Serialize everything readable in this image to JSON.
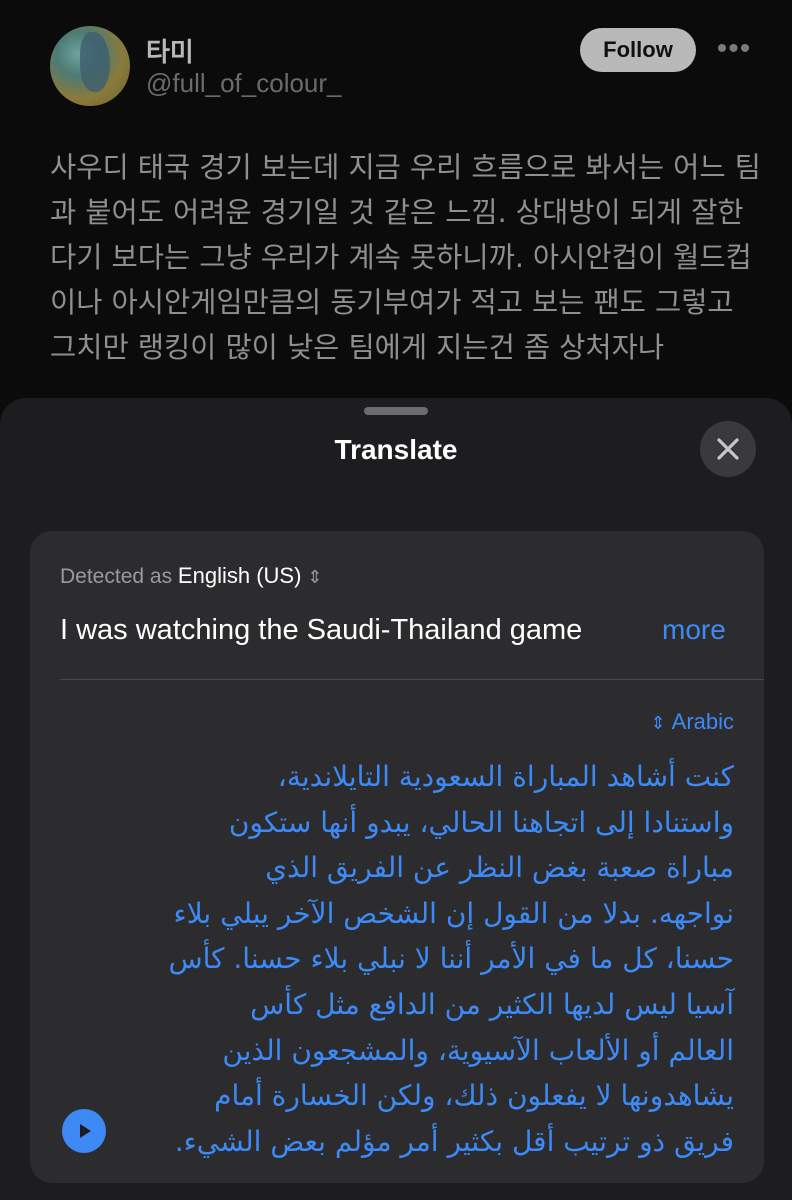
{
  "tweet": {
    "display_name": "타미",
    "handle": "@full_of_colour_",
    "follow_label": "Follow",
    "more_label": "•••",
    "text_lines": [
      "사우디 태국 경기 보는데 지금 우리 흐름으로 봐서는 어느 팀",
      "과 붙어도 어려운 경기일 것 같은 느낌. 상대방이 되게 잘한",
      "다기 보다는 그냥 우리가 계속 못하니까. 아시안컵이 월드컵",
      "이나 아시안게임만큼의 동기부여가 적고 보는 팬도 그렇고",
      "그치만 랭킹이 많이 낮은 팀에게 지는건 좀 상처자나"
    ]
  },
  "sheet": {
    "title": "Translate",
    "detected_prefix": "Detected as",
    "source_language": "English (US)",
    "source_text": "I was watching the Saudi-Thailand game",
    "more_label": "more",
    "target_language": "Arabic",
    "translation_lines": [
      "كنت أشاهد المباراة السعودية التايلاندية،",
      "واستنادا إلى اتجاهنا الحالي، يبدو أنها ستكون",
      "مباراة صعبة بغض النظر عن الفريق الذي",
      "نواجهه. بدلا من القول إن الشخص الآخر يبلي بلاء",
      "حسنا، كل ما في الأمر أننا لا نبلي بلاء حسنا. كأس",
      "آسيا ليس لديها الكثير من الدافع مثل كأس",
      "العالم أو الألعاب الآسيوية، والمشجعون الذين",
      "يشاهدونها لا يفعلون ذلك، ولكن الخسارة أمام",
      "فريق ذو ترتيب أقل بكثير أمر مؤلم بعض الشيء."
    ]
  },
  "colors": {
    "accent": "#3d8af7",
    "sheet_bg": "#1d1d1f",
    "card_bg": "#2c2c2e"
  },
  "icons": {
    "close": "close-icon",
    "play": "play-icon",
    "chevrons": "chevron-up-down-icon"
  }
}
